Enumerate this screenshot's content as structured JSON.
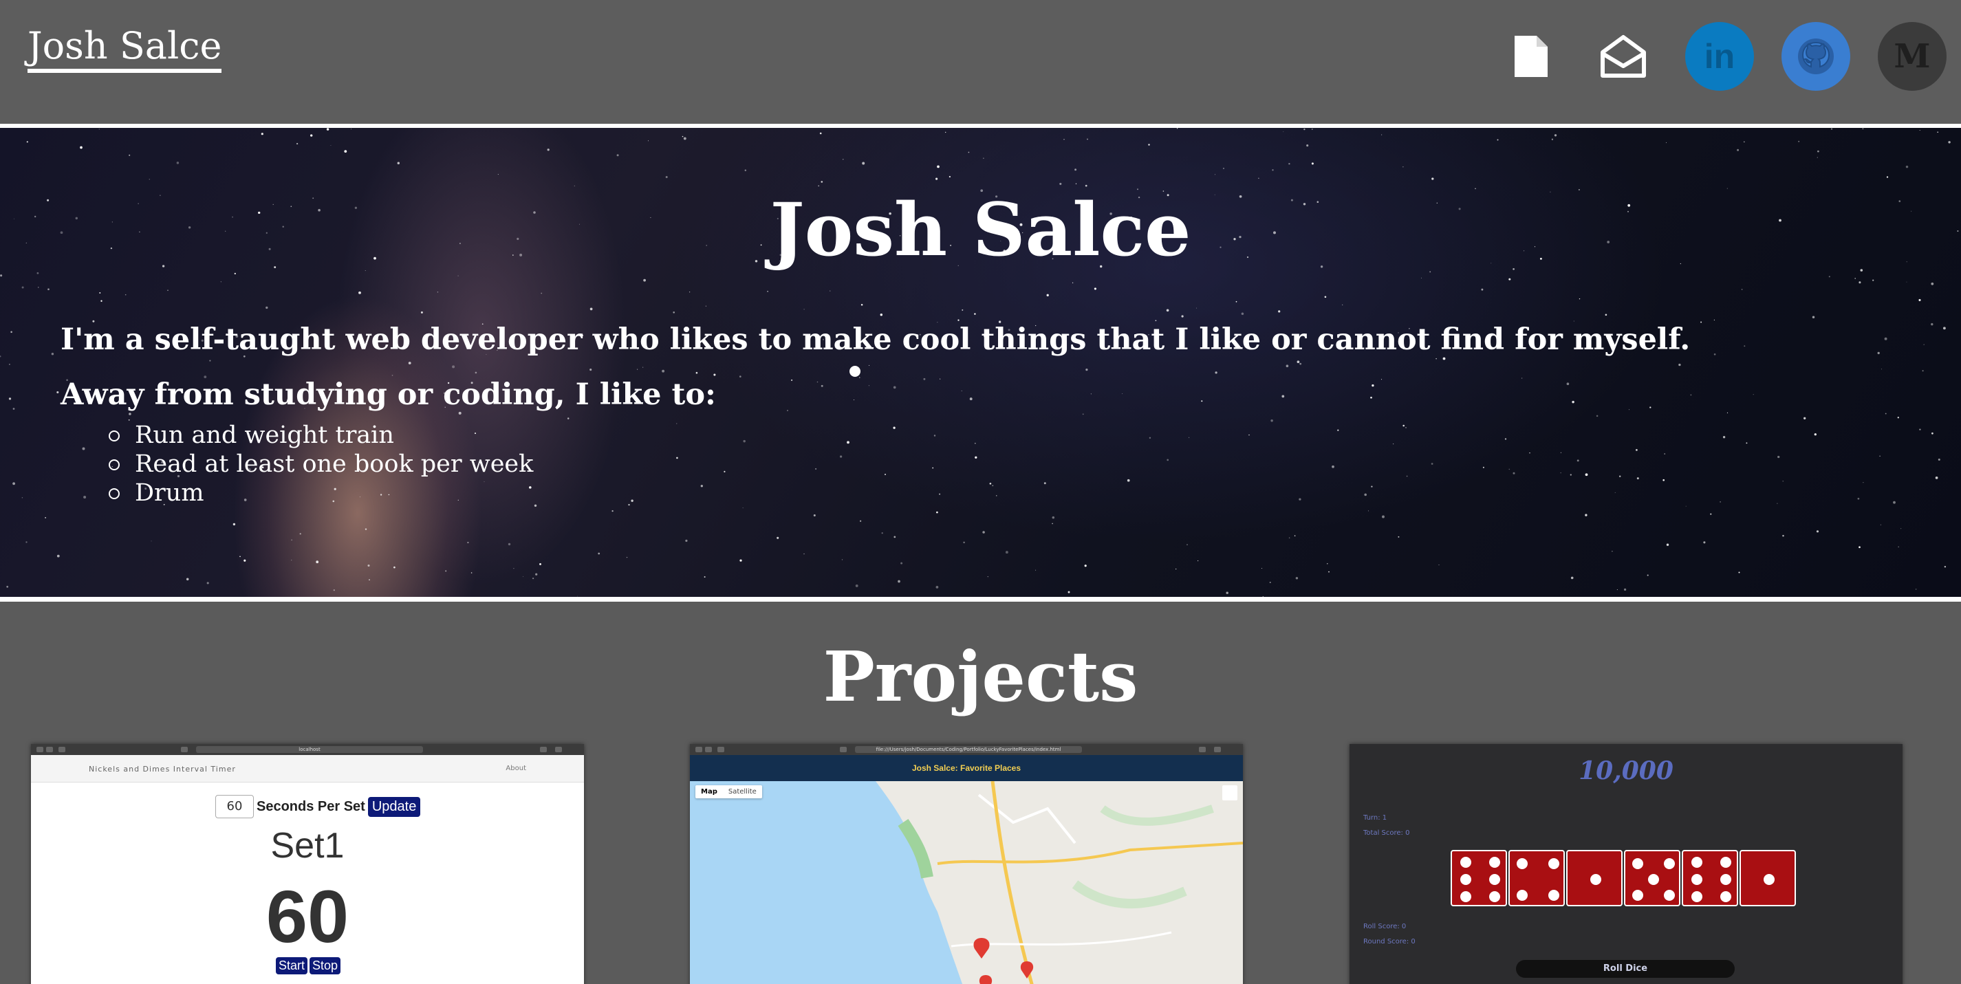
{
  "nav": {
    "brand": "Josh Salce",
    "icons": [
      "resume-icon",
      "email-icon",
      "linkedin-icon",
      "github-icon",
      "medium-icon"
    ],
    "medium_letter": "M",
    "linkedin_text": "in"
  },
  "hero": {
    "title": "Josh Salce",
    "intro": "I'm a self-taught web developer who likes to make cool things that I like or cannot find for myself.",
    "hobbies_heading": "Away from studying or coding, I like to:",
    "hobbies": [
      "Run and weight train",
      "Read at least one book per week",
      "Drum"
    ]
  },
  "projects": {
    "title": "Projects",
    "timer": {
      "url": "localhost",
      "brand": "Nickels and Dimes Interval Timer",
      "about": "About",
      "input_value": "60",
      "seconds_label": "Seconds Per Set",
      "update_label": "Update",
      "set_label": "Set1",
      "count": "60",
      "start_label": "Start",
      "stop_label": "Stop"
    },
    "map": {
      "url": "file:///Users/josh/Documents/Coding/Portfolio/LuckyFavoritePlaces/index.html",
      "header": "Josh Salce: Favorite Places",
      "map_label": "Map",
      "satellite_label": "Satellite"
    },
    "dice": {
      "title": "10,000",
      "turn": "Turn: 1",
      "total_score": "Total Score: 0",
      "roll_score": "Roll Score: 0",
      "round_score": "Round Score: 0",
      "roll_button": "Roll Dice",
      "faces": [
        6,
        4,
        1,
        5,
        6,
        1
      ]
    }
  },
  "colors": {
    "page_bg": "#5b5b5b",
    "linkedin": "#0a7bc1",
    "github": "#3a7ed1",
    "medium": "#3b3b3b",
    "navy_button": "#0d1a78",
    "die_red": "#a90f12",
    "map_header": "#132f4f",
    "map_header_text": "#f3cf52"
  }
}
